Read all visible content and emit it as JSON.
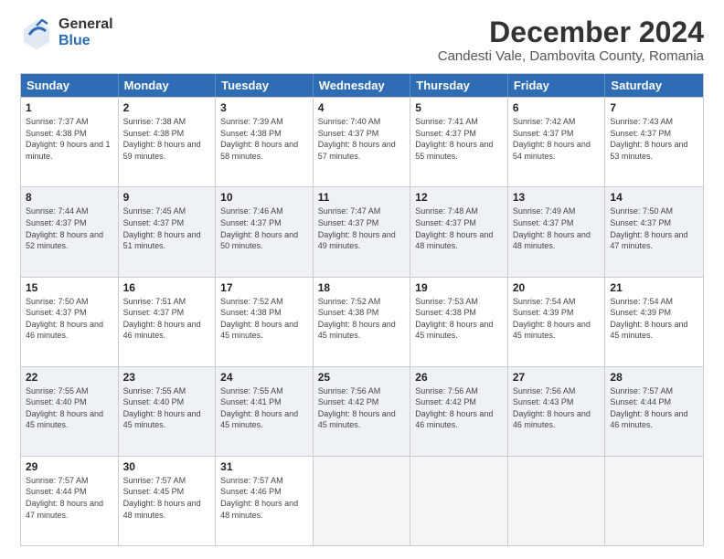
{
  "header": {
    "logo_general": "General",
    "logo_blue": "Blue",
    "title": "December 2024",
    "subtitle": "Candesti Vale, Dambovita County, Romania"
  },
  "calendar": {
    "days": [
      "Sunday",
      "Monday",
      "Tuesday",
      "Wednesday",
      "Thursday",
      "Friday",
      "Saturday"
    ],
    "weeks": [
      [
        {
          "num": "1",
          "sunrise": "7:37 AM",
          "sunset": "4:38 PM",
          "daylight": "9 hours and 1 minute."
        },
        {
          "num": "2",
          "sunrise": "7:38 AM",
          "sunset": "4:38 PM",
          "daylight": "8 hours and 59 minutes."
        },
        {
          "num": "3",
          "sunrise": "7:39 AM",
          "sunset": "4:38 PM",
          "daylight": "8 hours and 58 minutes."
        },
        {
          "num": "4",
          "sunrise": "7:40 AM",
          "sunset": "4:37 PM",
          "daylight": "8 hours and 57 minutes."
        },
        {
          "num": "5",
          "sunrise": "7:41 AM",
          "sunset": "4:37 PM",
          "daylight": "8 hours and 55 minutes."
        },
        {
          "num": "6",
          "sunrise": "7:42 AM",
          "sunset": "4:37 PM",
          "daylight": "8 hours and 54 minutes."
        },
        {
          "num": "7",
          "sunrise": "7:43 AM",
          "sunset": "4:37 PM",
          "daylight": "8 hours and 53 minutes."
        }
      ],
      [
        {
          "num": "8",
          "sunrise": "7:44 AM",
          "sunset": "4:37 PM",
          "daylight": "8 hours and 52 minutes."
        },
        {
          "num": "9",
          "sunrise": "7:45 AM",
          "sunset": "4:37 PM",
          "daylight": "8 hours and 51 minutes."
        },
        {
          "num": "10",
          "sunrise": "7:46 AM",
          "sunset": "4:37 PM",
          "daylight": "8 hours and 50 minutes."
        },
        {
          "num": "11",
          "sunrise": "7:47 AM",
          "sunset": "4:37 PM",
          "daylight": "8 hours and 49 minutes."
        },
        {
          "num": "12",
          "sunrise": "7:48 AM",
          "sunset": "4:37 PM",
          "daylight": "8 hours and 48 minutes."
        },
        {
          "num": "13",
          "sunrise": "7:49 AM",
          "sunset": "4:37 PM",
          "daylight": "8 hours and 48 minutes."
        },
        {
          "num": "14",
          "sunrise": "7:50 AM",
          "sunset": "4:37 PM",
          "daylight": "8 hours and 47 minutes."
        }
      ],
      [
        {
          "num": "15",
          "sunrise": "7:50 AM",
          "sunset": "4:37 PM",
          "daylight": "8 hours and 46 minutes."
        },
        {
          "num": "16",
          "sunrise": "7:51 AM",
          "sunset": "4:37 PM",
          "daylight": "8 hours and 46 minutes."
        },
        {
          "num": "17",
          "sunrise": "7:52 AM",
          "sunset": "4:38 PM",
          "daylight": "8 hours and 45 minutes."
        },
        {
          "num": "18",
          "sunrise": "7:52 AM",
          "sunset": "4:38 PM",
          "daylight": "8 hours and 45 minutes."
        },
        {
          "num": "19",
          "sunrise": "7:53 AM",
          "sunset": "4:38 PM",
          "daylight": "8 hours and 45 minutes."
        },
        {
          "num": "20",
          "sunrise": "7:54 AM",
          "sunset": "4:39 PM",
          "daylight": "8 hours and 45 minutes."
        },
        {
          "num": "21",
          "sunrise": "7:54 AM",
          "sunset": "4:39 PM",
          "daylight": "8 hours and 45 minutes."
        }
      ],
      [
        {
          "num": "22",
          "sunrise": "7:55 AM",
          "sunset": "4:40 PM",
          "daylight": "8 hours and 45 minutes."
        },
        {
          "num": "23",
          "sunrise": "7:55 AM",
          "sunset": "4:40 PM",
          "daylight": "8 hours and 45 minutes."
        },
        {
          "num": "24",
          "sunrise": "7:55 AM",
          "sunset": "4:41 PM",
          "daylight": "8 hours and 45 minutes."
        },
        {
          "num": "25",
          "sunrise": "7:56 AM",
          "sunset": "4:42 PM",
          "daylight": "8 hours and 45 minutes."
        },
        {
          "num": "26",
          "sunrise": "7:56 AM",
          "sunset": "4:42 PM",
          "daylight": "8 hours and 46 minutes."
        },
        {
          "num": "27",
          "sunrise": "7:56 AM",
          "sunset": "4:43 PM",
          "daylight": "8 hours and 46 minutes."
        },
        {
          "num": "28",
          "sunrise": "7:57 AM",
          "sunset": "4:44 PM",
          "daylight": "8 hours and 46 minutes."
        }
      ],
      [
        {
          "num": "29",
          "sunrise": "7:57 AM",
          "sunset": "4:44 PM",
          "daylight": "8 hours and 47 minutes."
        },
        {
          "num": "30",
          "sunrise": "7:57 AM",
          "sunset": "4:45 PM",
          "daylight": "8 hours and 48 minutes."
        },
        {
          "num": "31",
          "sunrise": "7:57 AM",
          "sunset": "4:46 PM",
          "daylight": "8 hours and 48 minutes."
        },
        null,
        null,
        null,
        null
      ]
    ]
  }
}
